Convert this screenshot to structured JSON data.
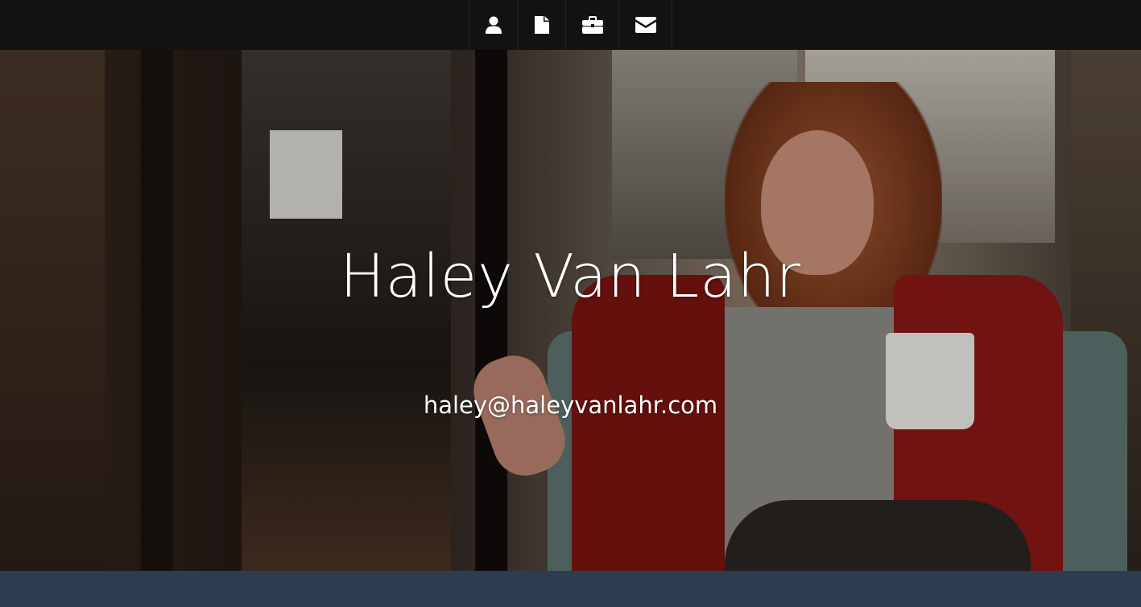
{
  "nav": {
    "items": [
      {
        "icon": "user-icon",
        "label": "About"
      },
      {
        "icon": "file-icon",
        "label": "Resume"
      },
      {
        "icon": "briefcase-icon",
        "label": "Portfolio"
      },
      {
        "icon": "envelope-icon",
        "label": "Contact"
      }
    ]
  },
  "hero": {
    "name": "Haley Van Lahr",
    "email": "haley@haleyvanlahr.com"
  },
  "colors": {
    "nav_bg": "#121212",
    "bottom_band": "#2e3c4f",
    "text": "#ffffff"
  }
}
